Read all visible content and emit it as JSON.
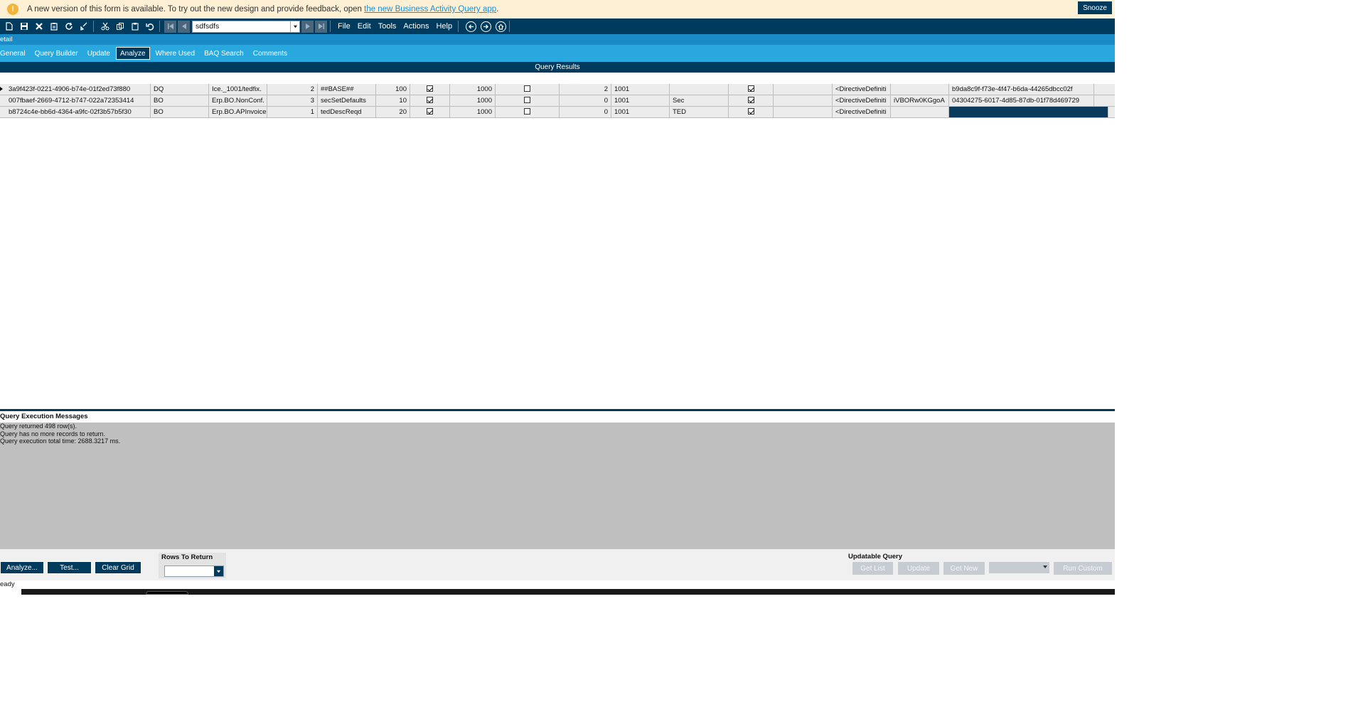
{
  "banner": {
    "message": "A new version of this form is available. To try out the new design and provide feedback, open ",
    "link_text": "the new Business Activity Query app",
    "after_link": ".",
    "snooze_label": "Snooze",
    "icon": "warning-icon"
  },
  "toolbar": {
    "record_value": "sdfsdfs",
    "menus": [
      "File",
      "Edit",
      "Tools",
      "Actions",
      "Help"
    ]
  },
  "detail_strip": "etail",
  "tabs": [
    {
      "label": "General"
    },
    {
      "label": "Query Builder"
    },
    {
      "label": "Update"
    },
    {
      "label": "Analyze"
    },
    {
      "label": "Where Used"
    },
    {
      "label": "BAQ Search"
    },
    {
      "label": "Comments"
    }
  ],
  "query_results_header": "Query Results",
  "grid": {
    "rows": [
      [
        "3a9f423f-0221-4906-b74e-01f2ed73f880",
        "DQ",
        "Ice._1001/tedfix.",
        "2",
        "##BASE##",
        "100",
        "",
        "1000",
        "",
        "2",
        "1001",
        "",
        "",
        "",
        "<DirectiveDefiniti",
        "",
        "b9da8c9f-f73e-4f47-b6da-44265dbcc02f"
      ],
      [
        "007fbaef-2669-4712-b747-022a72353414",
        "BO",
        "Erp.BO.NonConf.",
        "3",
        "secSetDefaults",
        "10",
        "",
        "1000",
        "",
        "0",
        "1001",
        "Sec",
        "",
        "",
        "<DirectiveDefiniti",
        "iVBORw0KGgoA",
        "04304275-6017-4d85-87db-01f78d469729"
      ],
      [
        "b8724c4e-bb6d-4364-a9fc-02f3b57b5f30",
        "BO",
        "Erp.BO.APInvoice",
        "1",
        "tedDescReqd",
        "20",
        "",
        "1000",
        "",
        "0",
        "1001",
        "TED",
        "",
        "",
        "<DirectiveDefiniti",
        "",
        ""
      ]
    ],
    "checks": [
      {
        "c1": true,
        "c2": false,
        "c3": true
      },
      {
        "c1": true,
        "c2": false,
        "c3": true
      },
      {
        "c1": true,
        "c2": false,
        "c3": true
      }
    ]
  },
  "messages": {
    "title": "Query Execution Messages",
    "lines": [
      "Query returned 498 row(s).",
      "Query has no more records to return.",
      "Query execution total time: 2688.3217 ms."
    ]
  },
  "bottom": {
    "analyze_label": "Analyze...",
    "test_label": "Test...",
    "clear_grid_label": "Clear Grid",
    "rows_to_return_label": "Rows To Return",
    "rows_to_return_value": "",
    "updatable_query_label": "Updatable Query",
    "get_list_label": "Get List",
    "update_label": "Update",
    "get_new_label": "Get New",
    "run_custom_label": "Run Custom"
  },
  "status": "eady",
  "colors": {
    "navy": "#003a5d",
    "tab_blue": "#29a8e0",
    "banner_bg": "#fdf0d5",
    "warning": "#f2b43a"
  }
}
